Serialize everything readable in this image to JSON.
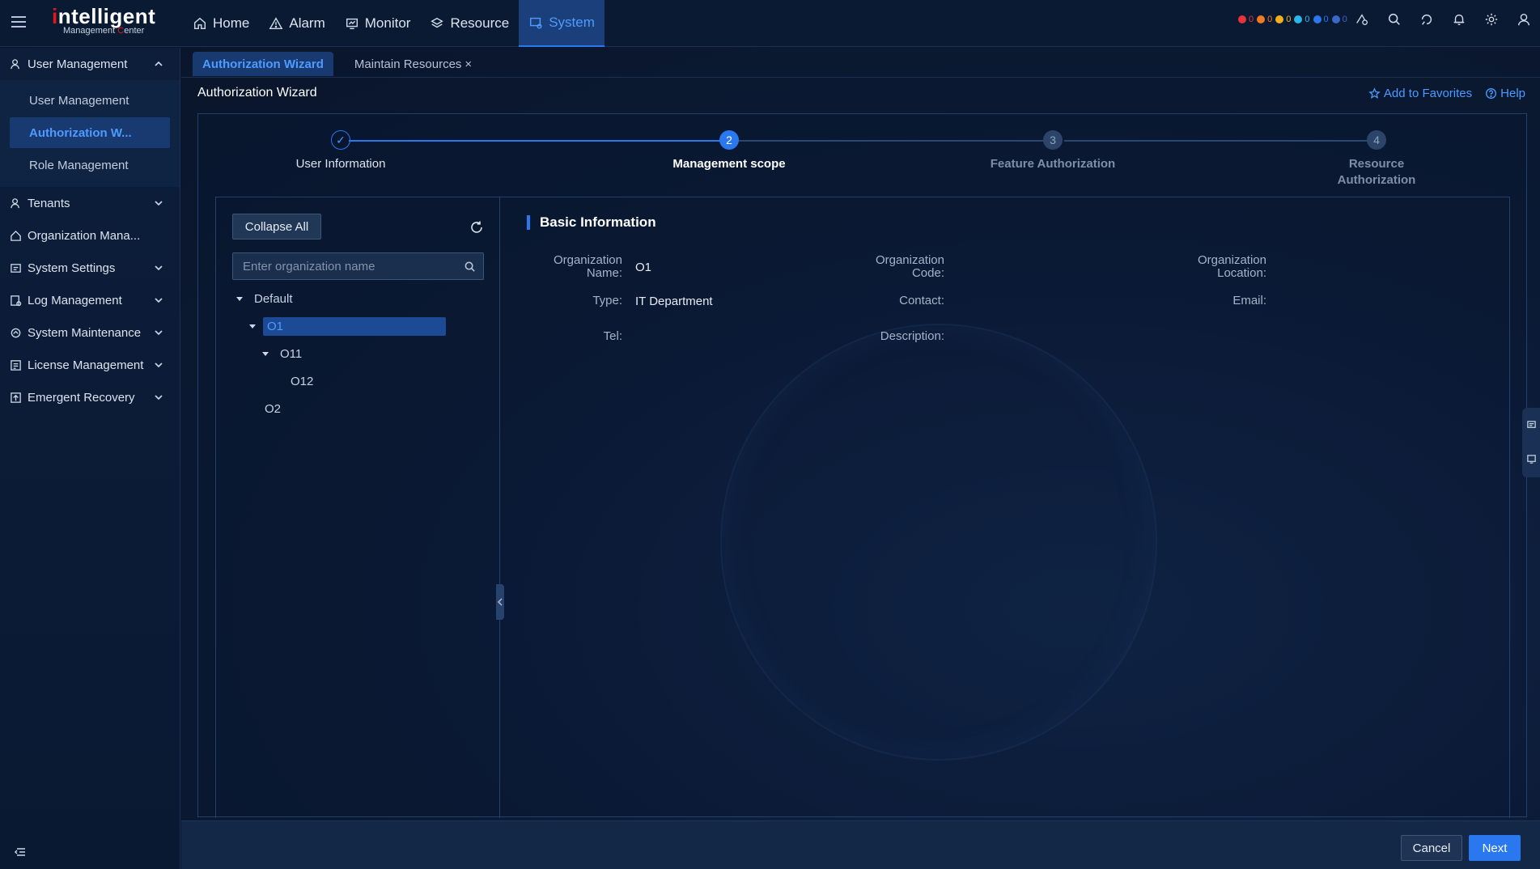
{
  "app": {
    "logo_main": "ntelligent",
    "logo_i": "i",
    "logo_sub_a": "Management ",
    "logo_sub_c": "C",
    "logo_sub_b": "enter"
  },
  "nav": [
    {
      "label": "Home",
      "icon": "home-icon"
    },
    {
      "label": "Alarm",
      "icon": "alarm-icon"
    },
    {
      "label": "Monitor",
      "icon": "monitor-icon"
    },
    {
      "label": "Resource",
      "icon": "resource-icon"
    },
    {
      "label": "System",
      "icon": "system-icon",
      "active": true
    }
  ],
  "alarm_counts": [
    {
      "count": "0",
      "color": "#e5353b"
    },
    {
      "count": "0",
      "color": "#f07b22"
    },
    {
      "count": "0",
      "color": "#f2b01e"
    },
    {
      "count": "0",
      "color": "#2bb5e8"
    },
    {
      "count": "0",
      "color": "#2a78f0"
    },
    {
      "count": "0",
      "color": "#3a67c9"
    }
  ],
  "sidebar": {
    "groups": [
      {
        "label": "User Management",
        "icon": "user-icon",
        "expanded": true,
        "items": [
          {
            "label": "User Management"
          },
          {
            "label": "Authorization W...",
            "active": true
          },
          {
            "label": "Role Management"
          }
        ]
      },
      {
        "label": "Tenants",
        "icon": "tenant-icon"
      },
      {
        "label": "Organization Mana...",
        "icon": "organization-icon"
      },
      {
        "label": "System Settings",
        "icon": "settings-icon"
      },
      {
        "label": "Log Management",
        "icon": "log-icon"
      },
      {
        "label": "System Maintenance",
        "icon": "maintenance-icon"
      },
      {
        "label": "License Management",
        "icon": "license-icon"
      },
      {
        "label": "Emergent Recovery",
        "icon": "recovery-icon"
      }
    ]
  },
  "tabs": [
    {
      "label": "Authorization Wizard",
      "active": true
    },
    {
      "label": "Maintain Resources",
      "closable": true,
      "close": "×"
    }
  ],
  "page": {
    "title": "Authorization Wizard",
    "add_favorites": "Add to Favorites",
    "help": "Help"
  },
  "wizard": {
    "current_step": 2,
    "steps": [
      {
        "num": "✓",
        "label": "User Information",
        "state": "done"
      },
      {
        "num": "2",
        "label": "Management scope",
        "state": "current"
      },
      {
        "num": "3",
        "label": "Feature Authorization",
        "state": "todo"
      },
      {
        "num": "4",
        "label": "Resource Authorization",
        "state": "todo"
      }
    ]
  },
  "tree": {
    "collapse_all": "Collapse All",
    "search_placeholder": "Enter organization name",
    "nodes": [
      {
        "label": "Default",
        "level": 0,
        "expandable": true
      },
      {
        "label": "O1",
        "level": 1,
        "expandable": true,
        "selected": true
      },
      {
        "label": "O11",
        "level": 2,
        "expandable": true
      },
      {
        "label": "O12",
        "level": 3
      },
      {
        "label": "O2",
        "level": 1
      }
    ]
  },
  "basic_info": {
    "title": "Basic Information",
    "fields": {
      "org_name": {
        "label": "Organization Name:",
        "value": "O1"
      },
      "org_code": {
        "label": "Organization Code:",
        "value": ""
      },
      "org_location": {
        "label": "Organization Location:",
        "value": ""
      },
      "type": {
        "label": "Type:",
        "value": "IT Department"
      },
      "contact": {
        "label": "Contact:",
        "value": ""
      },
      "email": {
        "label": "Email:",
        "value": ""
      },
      "tel": {
        "label": "Tel:",
        "value": ""
      },
      "description": {
        "label": "Description:",
        "value": ""
      }
    }
  },
  "footer": {
    "cancel": "Cancel",
    "next": "Next"
  }
}
